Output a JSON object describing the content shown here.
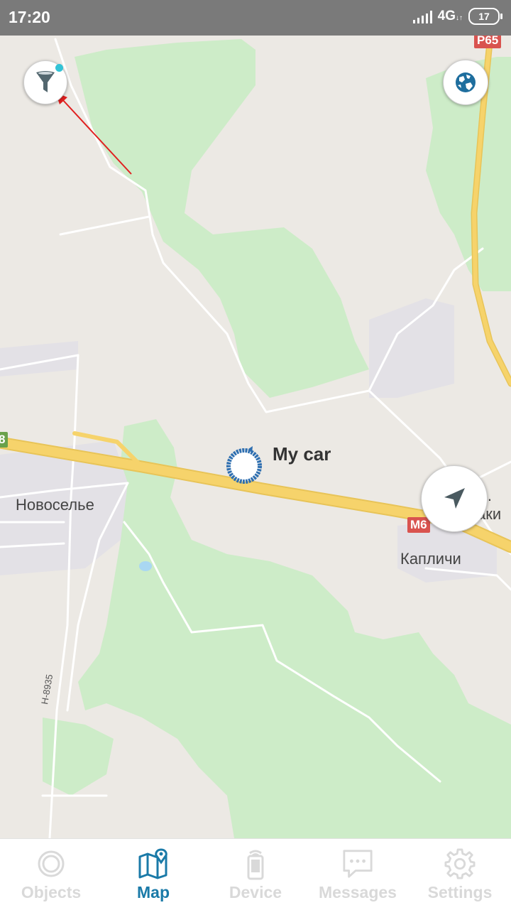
{
  "status_bar": {
    "time": "17:20",
    "network": "4G",
    "network_sub": "↓↑",
    "battery": "17"
  },
  "map": {
    "place_labels": [
      "Новоселье",
      "Капличи",
      "…аки"
    ],
    "road_shields": [
      "P65",
      "M6",
      "8"
    ],
    "road_number": "H-8935",
    "marker_label": "My car",
    "colors": {
      "land": "#ece9e4",
      "forest": "#cdecc8",
      "highway": "#f6d36b",
      "road": "#ffffff",
      "shield_red": "#d9534f",
      "shield_green": "#6aa14b",
      "marker": "#2f6fb0",
      "annotation_arrow": "#e02020"
    },
    "controls": {
      "filter_icon": "funnel-icon",
      "layers_icon": "globe-icon",
      "locate_icon": "navigation-arrow-icon"
    }
  },
  "bottom_nav": {
    "active_color": "#1a7aa8",
    "inactive_color": "#d9d9d9",
    "items": [
      {
        "label": "Objects",
        "icon": "ring-icon",
        "active": false
      },
      {
        "label": "Map",
        "icon": "map-pin-icon",
        "active": true
      },
      {
        "label": "Device",
        "icon": "phone-signal-icon",
        "active": false
      },
      {
        "label": "Messages",
        "icon": "chat-bubble-icon",
        "active": false
      },
      {
        "label": "Settings",
        "icon": "gear-icon",
        "active": false
      }
    ]
  }
}
